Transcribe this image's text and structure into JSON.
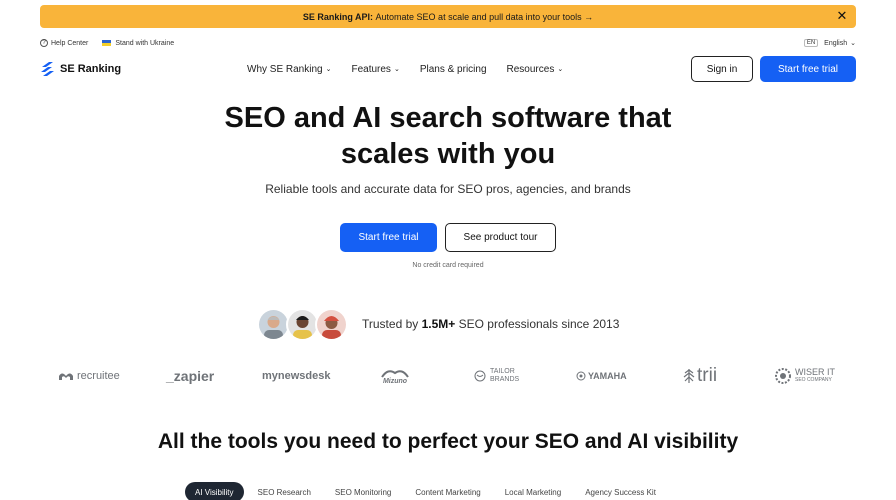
{
  "banner": {
    "bold": "SE Ranking API:",
    "text": "Automate SEO at scale and pull data into your tools →",
    "close": "✕"
  },
  "utility": {
    "help": "Help Center",
    "ukraine": "Stand with Ukraine",
    "lang_code": "EN",
    "lang": "English"
  },
  "nav": {
    "logo": "SE Ranking",
    "menu": [
      "Why SE Ranking",
      "Features",
      "Plans & pricing",
      "Resources"
    ],
    "signin": "Sign in",
    "trial": "Start free trial"
  },
  "hero": {
    "title_line1": "SEO and AI search software that",
    "title_line2": "scales with you",
    "subtitle": "Reliable tools and accurate data for SEO pros, agencies, and brands",
    "primary_cta": "Start free trial",
    "secondary_cta": "See product tour",
    "note": "No credit card required"
  },
  "trusted": {
    "prefix": "Trusted by",
    "count": "1.5M+",
    "suffix": "SEO professionals since 2013"
  },
  "logos": {
    "recruitee": "recruitee",
    "zapier": "_zapier",
    "newsdesk": "mynewsdesk",
    "mizuno": "Mizuno",
    "tailor_1": "TAILOR",
    "tailor_2": "BRANDS",
    "yamaha": "YAMAHA",
    "trii": "trii",
    "wiser_1": "WISER IT",
    "wiser_2": "SEO COMPANY"
  },
  "tools": {
    "title": "All the tools you need to perfect your SEO and AI visibility",
    "tabs": [
      "AI Visibility",
      "SEO Research",
      "SEO Monitoring",
      "Content Marketing",
      "Local Marketing",
      "Agency Success Kit"
    ]
  },
  "colors": {
    "banner": "#f9b43a",
    "primary": "#1560f4",
    "tab_active": "#1f2733"
  }
}
